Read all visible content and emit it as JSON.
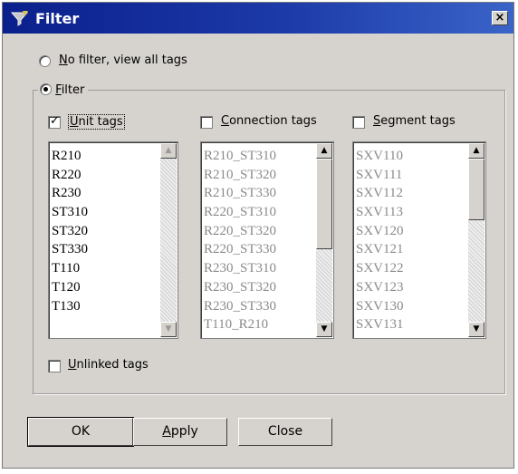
{
  "window": {
    "title": "Filter",
    "close_glyph": "×"
  },
  "options": {
    "no_filter": {
      "accel": "N",
      "label": "o filter, view all tags",
      "checked": false
    },
    "filter": {
      "accel": "F",
      "label": "ilter",
      "checked": true
    }
  },
  "checkboxes": {
    "unit": {
      "accel": "U",
      "label": "nit tags",
      "checked": true
    },
    "connection": {
      "accel": "C",
      "label": "onnection tags",
      "checked": false
    },
    "segment": {
      "accel": "S",
      "label": "egment tags",
      "checked": false
    },
    "unlinked": {
      "accel": "U",
      "label": "nlinked tags",
      "checked": false
    }
  },
  "lists": {
    "unit": [
      "R210",
      "R220",
      "R230",
      "ST310",
      "ST320",
      "ST330",
      "T110",
      "T120",
      "T130"
    ],
    "connection": [
      "R210_ST310",
      "R210_ST320",
      "R210_ST330",
      "R220_ST310",
      "R220_ST320",
      "R220_ST330",
      "R230_ST310",
      "R230_ST320",
      "R230_ST330",
      "T110_R210"
    ],
    "segment": [
      "SXV110",
      "SXV111",
      "SXV112",
      "SXV113",
      "SXV120",
      "SXV121",
      "SXV122",
      "SXV123",
      "SXV130",
      "SXV131"
    ]
  },
  "buttons": {
    "ok": "OK",
    "apply": {
      "accel": "A",
      "label": "pply"
    },
    "close": "Close"
  },
  "icons": {
    "app": "filter-app-icon",
    "close": "close-icon",
    "arrow_up": "arrow-up-icon",
    "arrow_down": "arrow-down-icon",
    "check": "check-icon"
  },
  "colors": {
    "titlebar_start": "#0a1f8c",
    "titlebar_end": "#3a64c8",
    "dialog_bg": "#d6d3ce",
    "disabled_text": "#8a8a8a"
  }
}
